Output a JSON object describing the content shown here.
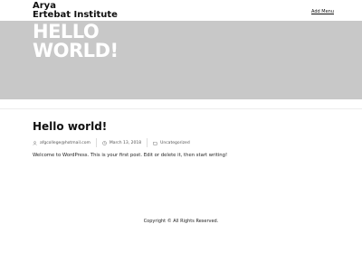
{
  "header": {
    "site_title_line1": "Arya",
    "site_title_line2": "Ertebat Institute",
    "menu_link": "Add Menu"
  },
  "hero": {
    "title_line1": "HELLO",
    "title_line2": "WORLD!"
  },
  "post": {
    "title": "Hello world!",
    "meta": {
      "author": "afgcollege@hotmail.com",
      "date": "March 13, 2018",
      "category": "Uncategorized"
    },
    "content": "Welcome to WordPress. This is your first post. Edit or delete it, then start writing!"
  },
  "footer": {
    "copyright": "Copyright © All Rights Reserved."
  },
  "icons": {
    "author": "user-icon",
    "date": "clock-icon",
    "category": "folder-icon"
  },
  "colors": {
    "hero_background": "#c8c8c8",
    "hero_text": "#ffffff",
    "text": "#111111"
  }
}
